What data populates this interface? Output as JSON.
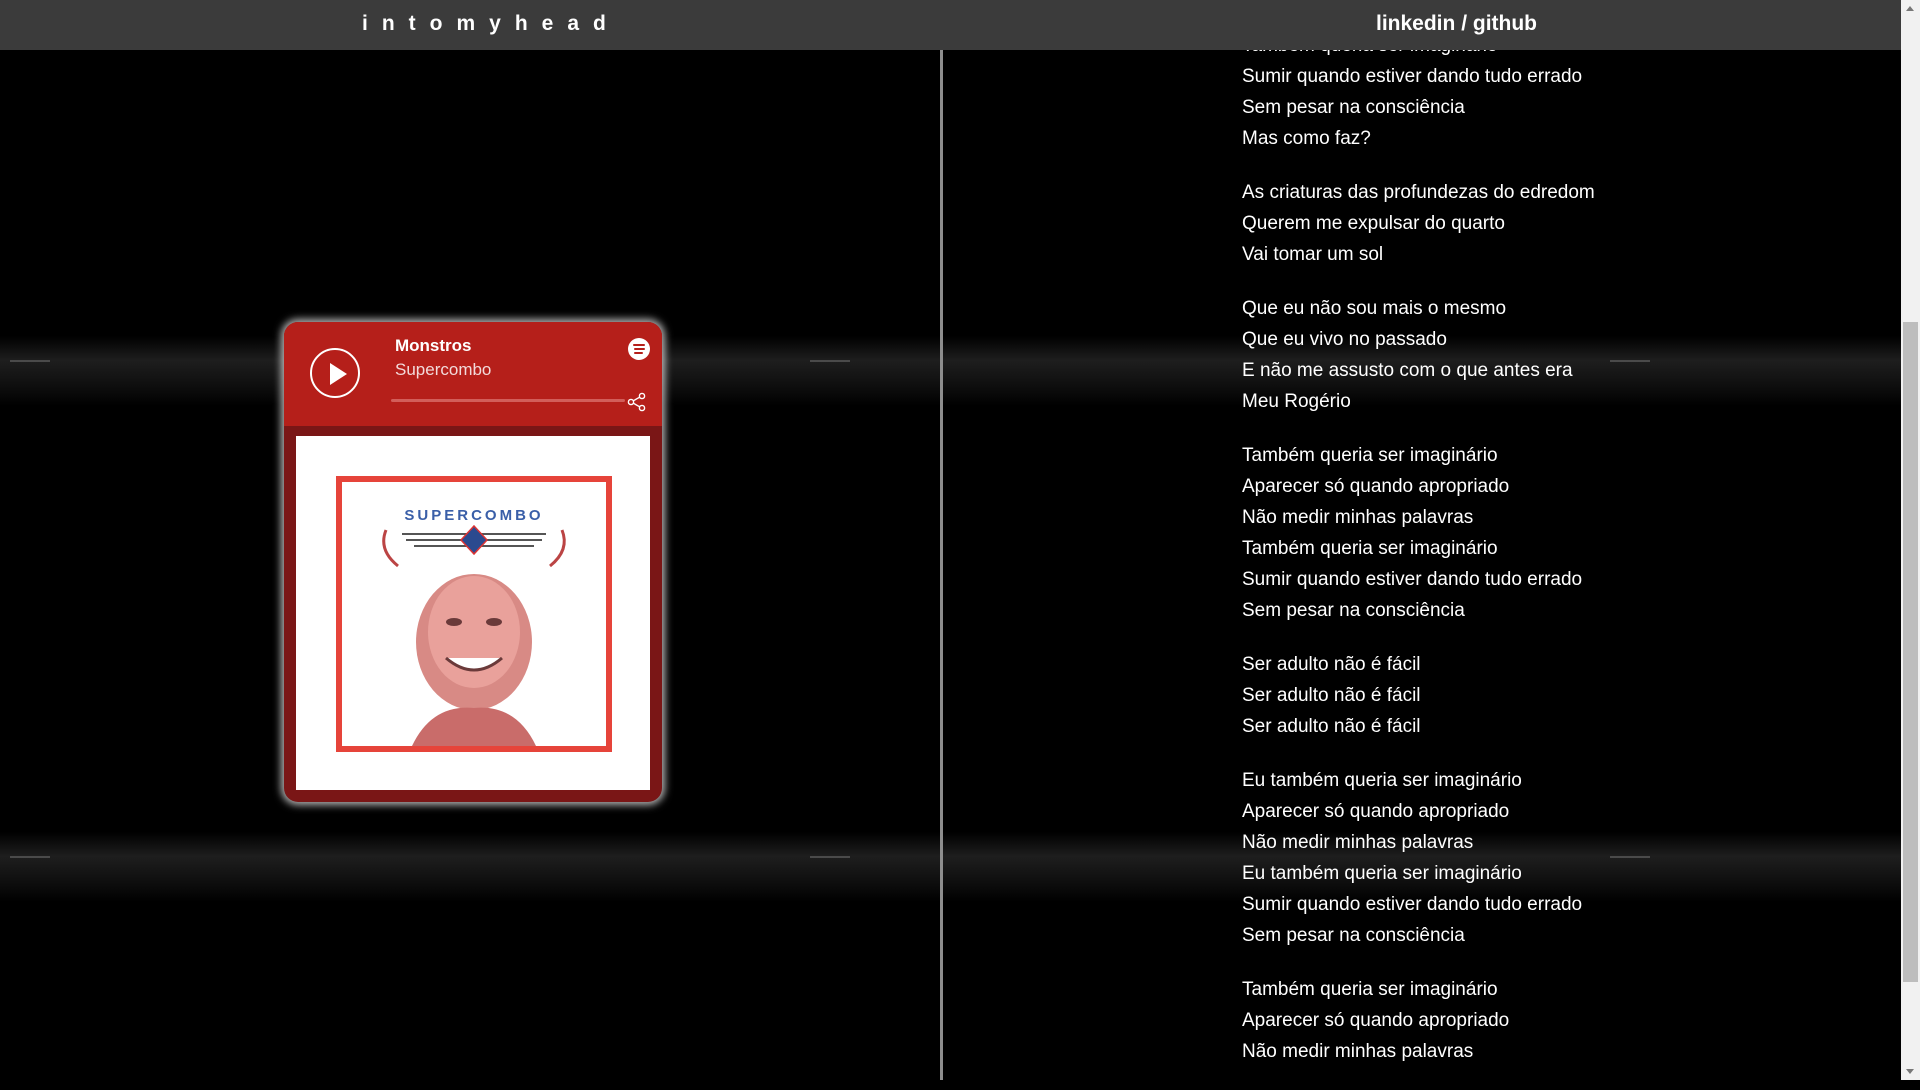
{
  "header": {
    "brand": "intomyhead",
    "links": {
      "linkedin": "linkedin",
      "separator": " / ",
      "github": "github"
    }
  },
  "player": {
    "track_title": "Monstros",
    "artist": "Supercombo",
    "progress": 0,
    "album_text": "SUPERCOMBO",
    "colors": {
      "header": "#b51f1a",
      "body": "#7a1616",
      "art_border": "#e6443a"
    }
  },
  "lyrics": [
    [
      "Também queria ser imaginário",
      "Sumir quando estiver dando tudo errado",
      "Sem pesar na consciência",
      "Mas como faz?"
    ],
    [
      "As criaturas das profundezas do edredom",
      "Querem me expulsar do quarto",
      "Vai tomar um sol"
    ],
    [
      "Que eu não sou mais o mesmo",
      "Que eu vivo no passado",
      "E não me assusto com o que antes era",
      "Meu Rogério"
    ],
    [
      "Também queria ser imaginário",
      "Aparecer só quando apropriado",
      "Não medir minhas palavras",
      "Também queria ser imaginário",
      "Sumir quando estiver dando tudo errado",
      "Sem pesar na consciência"
    ],
    [
      "Ser adulto não é fácil",
      "Ser adulto não é fácil",
      "Ser adulto não é fácil"
    ],
    [
      "Eu também queria ser imaginário",
      "Aparecer só quando apropriado",
      "Não medir minhas palavras",
      "Eu também queria ser imaginário",
      "Sumir quando estiver dando tudo errado",
      "Sem pesar na consciência"
    ],
    [
      "Também queria ser imaginário",
      "Aparecer só quando apropriado",
      "Não medir minhas palavras"
    ]
  ]
}
